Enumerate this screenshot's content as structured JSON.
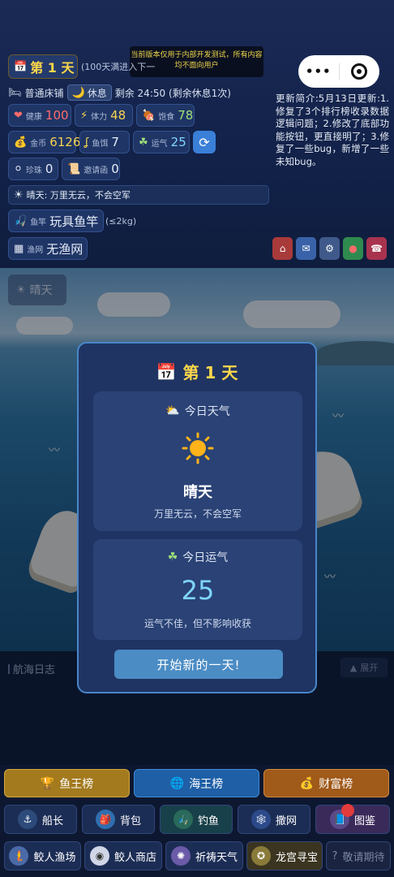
{
  "dev_notice": "当前版本仅用于内部开发测试，所有内容均不面向用户",
  "capsule": {
    "more": "•••",
    "close": "◎"
  },
  "status": {
    "day_label": "第 1 天",
    "day_note": "(100天满进入下一",
    "bed": "普通床铺",
    "rest_label": "休息",
    "remaining": "剩余 24:50 (剩余休息1次)",
    "health_label": "健康",
    "health": "100",
    "stamina_label": "体力",
    "stamina": "48",
    "satiety_label": "饱食",
    "satiety": "78",
    "gold_label": "金币",
    "gold": "6126",
    "bait_label": "鱼饵",
    "bait": "7",
    "luck_label": "运气",
    "luck": "25",
    "pearl_label": "珍珠",
    "pearl": "0",
    "invite_label": "邀请函",
    "invite": "0",
    "weather_line": "晴天: 万里无云，不会空军",
    "rod_label": "鱼竿",
    "rod": "玩具鱼竿",
    "rod_limit": "(≤2kg)",
    "net_label": "渔网",
    "net": "无渔网"
  },
  "update_notes": "更新简介:5月13日更新:1.修复了3个排行榜收录数据逻辑问题；2.修改了底部功能按钮，更直接明了；3.修复了一些bug，新增了一些未知bug。",
  "scene": {
    "weather_badge": "晴天"
  },
  "log": {
    "title": "航海日志",
    "expand": "展开"
  },
  "modal": {
    "title": "第 1 天",
    "weather_head": "今日天气",
    "weather_name": "晴天",
    "weather_desc": "万里无云，不会空军",
    "luck_head": "今日运气",
    "luck_value": "25",
    "luck_desc": "运气不佳，但不影响收获",
    "start_button": "开始新的一天!"
  },
  "ranks": [
    {
      "label": "鱼王榜",
      "color": "#b8860b"
    },
    {
      "label": "海王榜",
      "color": "#1f6fb8"
    },
    {
      "label": "财富榜",
      "color": "#b8641a"
    }
  ],
  "nav1": [
    "船长",
    "背包",
    "钓鱼",
    "撒网",
    "图鉴"
  ],
  "nav2": [
    "鲛人渔场",
    "鲛人商店",
    "祈祷天气",
    "龙宫寻宝",
    "敬请期待"
  ]
}
